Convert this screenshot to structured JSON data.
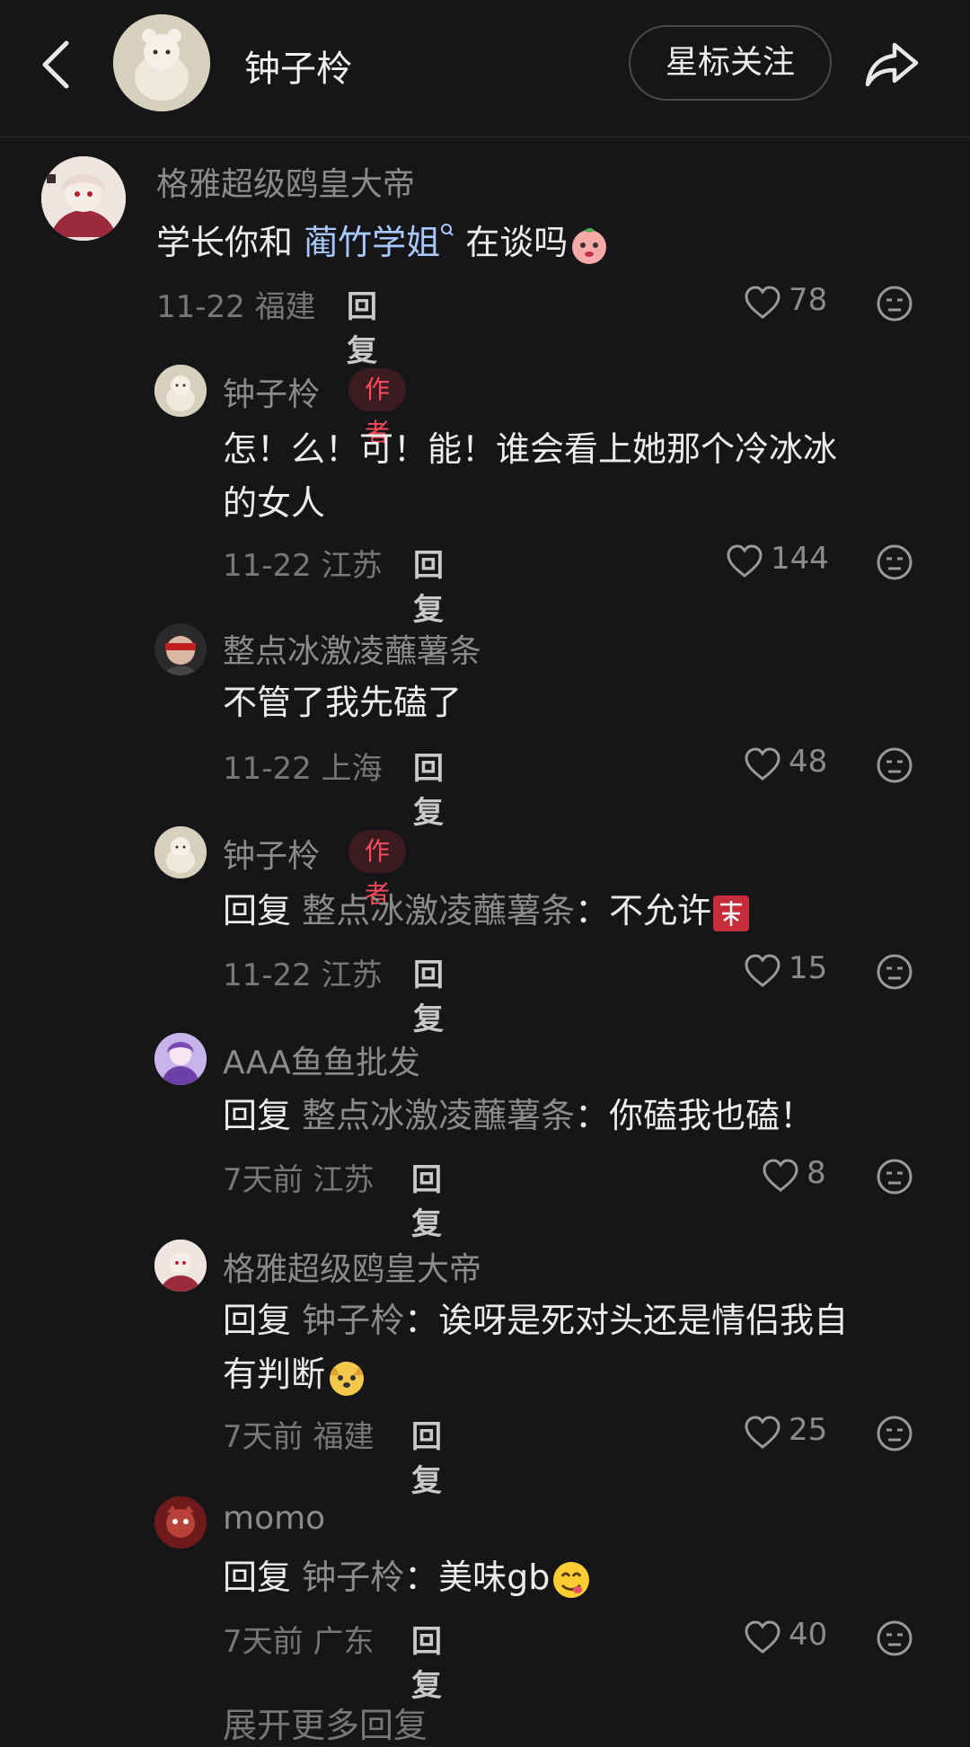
{
  "header": {
    "title": "钟子柃",
    "follow_label": "星标关注"
  },
  "comments": [
    {
      "user": "格雅超级鸥皇大帝",
      "text_a": "学长你和 ",
      "text_link": "蔺竹学姐",
      "text_b": " 在谈吗",
      "meta": "11-22 福建",
      "reply_label": "回复",
      "likes": "78"
    },
    {
      "user": "钟子柃",
      "tag": "作者",
      "line1": "怎！么！可！能！谁会看上她那个冷冰冰",
      "line2": "的女人",
      "meta": "11-22 江苏",
      "reply_label": "回复",
      "likes": "144"
    },
    {
      "user": "整点冰激凌蘸薯条",
      "text": "不管了我先磕了",
      "meta": "11-22 上海",
      "reply_label": "回复",
      "likes": "48"
    },
    {
      "user": "钟子柃",
      "tag": "作者",
      "prefix": "回复",
      "target": "整点冰激凌蘸薯条",
      "text": "：不允许",
      "meta": "11-22 江苏",
      "reply_label": "回复",
      "likes": "15"
    },
    {
      "user": "AAA鱼鱼批发",
      "prefix": "回复",
      "target": "整点冰激凌蘸薯条",
      "text": "：你磕我也磕！",
      "meta": "7天前 江苏",
      "reply_label": "回复",
      "likes": "8"
    },
    {
      "user": "格雅超级鸥皇大帝",
      "prefix": "回复",
      "target": "钟子柃",
      "text": "：诶呀是死对头还是情侣我自",
      "line2": "有判断",
      "meta": "7天前 福建",
      "reply_label": "回复",
      "likes": "25"
    },
    {
      "user": "momo",
      "prefix": "回复",
      "target": "钟子柃",
      "text": "：美味gb",
      "meta": "7天前 广东",
      "reply_label": "回复",
      "likes": "40"
    }
  ],
  "footer": {
    "more_replies": "展开更多回复"
  },
  "colors": {
    "background": "#161618",
    "author_tag": "#ff4b5c",
    "link": "#a8c8ff"
  }
}
